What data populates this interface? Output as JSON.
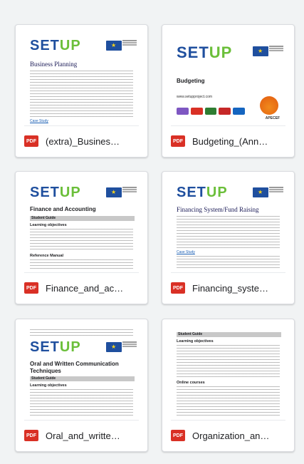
{
  "files": [
    {
      "name": "(extra)_Business_Planning.pdf",
      "display": "(extra)_Busines…",
      "type": "PDF",
      "thumb": {
        "logo_a": "SET",
        "logo_b": "UP",
        "title": "Business Planning",
        "link": "Case Study"
      }
    },
    {
      "name": "Budgeting_(Annex).pdf",
      "display": "Budgeting_(Ann…",
      "type": "PDF",
      "thumb": {
        "logo_a": "SET",
        "logo_b": "UP",
        "title": "Budgeting",
        "url": "www.setupproject.com",
        "partner": "APECEF"
      }
    },
    {
      "name": "Finance_and_Accounting.pdf",
      "display": "Finance_and_ac…",
      "type": "PDF",
      "thumb": {
        "logo_a": "SET",
        "logo_b": "UP",
        "title": "Finance and Accounting",
        "bar": "Student Guide",
        "heading1": "Learning objectives",
        "heading2": "Reference Manual"
      }
    },
    {
      "name": "Financing_system_Fund_Raising.pdf",
      "display": "Financing_syste…",
      "type": "PDF",
      "thumb": {
        "logo_a": "SET",
        "logo_b": "UP",
        "title": "Financing System/Fund Raising",
        "link": "Case Study"
      }
    },
    {
      "name": "Oral_and_written_Communication.pdf",
      "display": "Oral_and_writte…",
      "type": "PDF",
      "thumb": {
        "logo_a": "SET",
        "logo_b": "UP",
        "title_l1": "Oral and Written Communication",
        "title_l2": "Techniques",
        "bar": "Student Guide",
        "heading1": "Learning objectives"
      }
    },
    {
      "name": "Organization_and_Management.pdf",
      "display": "Organization_an…",
      "type": "PDF",
      "thumb": {
        "bar": "Student Guide",
        "heading1": "Learning objectives",
        "heading2": "Online courses"
      }
    }
  ],
  "colors": {
    "pdf_badge": "#d93025",
    "logo_blue": "#1f4f9e",
    "logo_green": "#6bbf3a"
  }
}
